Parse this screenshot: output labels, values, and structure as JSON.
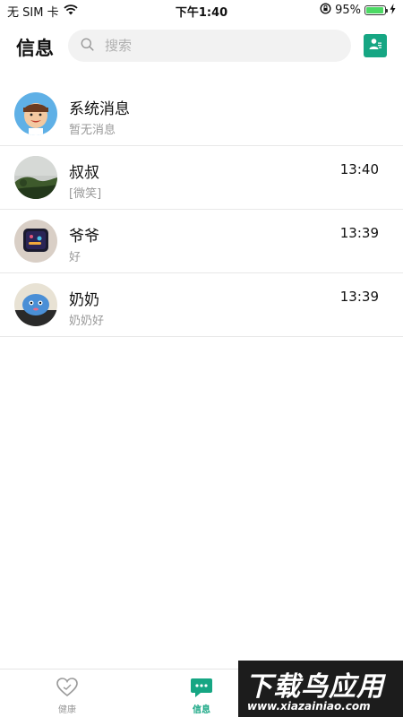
{
  "status_bar": {
    "carrier": "无 SIM 卡",
    "time": "下午1:40",
    "battery_percent": "95%",
    "battery_level": 0.95
  },
  "header": {
    "title": "信息",
    "search_placeholder": "搜索"
  },
  "messages": [
    {
      "name": "系统消息",
      "preview": "暂无消息",
      "time": "",
      "avatar": "cartoon-face"
    },
    {
      "name": "叔叔",
      "preview": "[微笑]",
      "time": "13:40",
      "avatar": "landscape-photo"
    },
    {
      "name": "爷爷",
      "preview": "好",
      "time": "13:39",
      "avatar": "watch-photo"
    },
    {
      "name": "奶奶",
      "preview": "奶奶好",
      "time": "13:39",
      "avatar": "toy-photo"
    }
  ],
  "tabs": [
    {
      "label": "健康",
      "icon": "heart-icon",
      "active": false
    },
    {
      "label": "信息",
      "icon": "chat-bubble-icon",
      "active": true
    }
  ],
  "watermark": {
    "title": "下载鸟应用",
    "url": "www.xiazainiao.com"
  },
  "colors": {
    "accent": "#16a683",
    "battery": "#4cd964"
  }
}
